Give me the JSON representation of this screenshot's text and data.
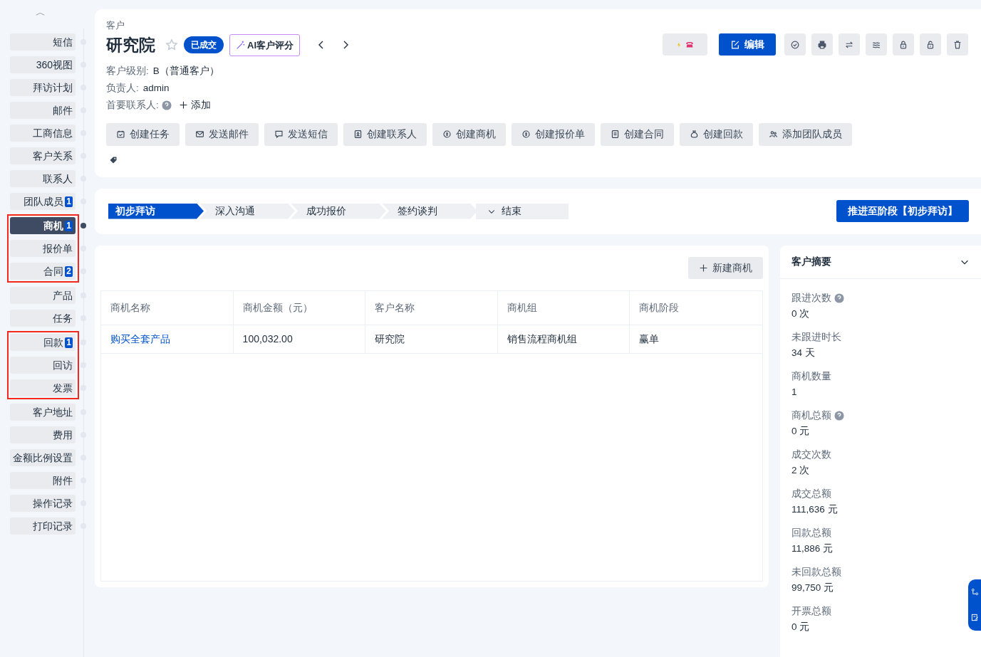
{
  "sidebar": {
    "collapse_glyph": "︿",
    "groups": [
      {
        "highlighted": false,
        "items": [
          {
            "label": "短信",
            "selected": false
          },
          {
            "label": "360视图",
            "selected": false
          },
          {
            "label": "拜访计划",
            "selected": false
          },
          {
            "label": "邮件",
            "selected": false
          },
          {
            "label": "工商信息",
            "selected": false
          },
          {
            "label": "客户关系",
            "selected": false
          },
          {
            "label": "联系人",
            "selected": false
          },
          {
            "label": "团队成员",
            "count": "1",
            "selected": false
          }
        ]
      },
      {
        "highlighted": true,
        "items": [
          {
            "label": "商机",
            "count": "1",
            "selected": true
          },
          {
            "label": "报价单",
            "selected": false
          },
          {
            "label": "合同",
            "count": "2",
            "selected": false
          }
        ]
      },
      {
        "highlighted": false,
        "items": [
          {
            "label": "产品",
            "selected": false
          },
          {
            "label": "任务",
            "selected": false
          }
        ]
      },
      {
        "highlighted": true,
        "items": [
          {
            "label": "回款",
            "count": "1",
            "selected": false
          },
          {
            "label": "回访",
            "selected": false
          },
          {
            "label": "发票",
            "selected": false
          }
        ]
      },
      {
        "highlighted": false,
        "items": [
          {
            "label": "客户地址",
            "selected": false
          },
          {
            "label": "费用",
            "selected": false
          },
          {
            "label": "金额比例设置",
            "selected": false
          },
          {
            "label": "附件",
            "selected": false
          },
          {
            "label": "操作记录",
            "selected": false
          },
          {
            "label": "打印记录",
            "selected": false
          }
        ]
      }
    ]
  },
  "header": {
    "breadcrumb": "客户",
    "title": "研究院",
    "starred": false,
    "status_badge": "已成交",
    "ai_button": "AI客户评分",
    "fields": [
      {
        "label": "客户级别:",
        "value": "B（普通客户）"
      },
      {
        "label": "负责人:",
        "value": "admin"
      }
    ],
    "primary_contact": {
      "label": "首要联系人:",
      "add": "添加"
    },
    "edit_button": "编辑",
    "actions": [
      "创建任务",
      "发送邮件",
      "发送短信",
      "创建联系人",
      "创建商机",
      "创建报价单",
      "创建合同",
      "创建回款",
      "添加团队成员"
    ]
  },
  "stages": {
    "steps": [
      {
        "label": "初步拜访",
        "selected": true,
        "kind": "step"
      },
      {
        "label": "深入沟通",
        "selected": false,
        "kind": "step"
      },
      {
        "label": "成功报价",
        "selected": false,
        "kind": "step"
      },
      {
        "label": "签约谈判",
        "selected": false,
        "kind": "step"
      },
      {
        "label": "结束",
        "selected": false,
        "kind": "end"
      }
    ],
    "advance_button": "推进至阶段【初步拜访】"
  },
  "opportunities": {
    "new_button": "新建商机",
    "columns": [
      "商机名称",
      "商机金额（元）",
      "客户名称",
      "商机组",
      "商机阶段"
    ],
    "rows": [
      [
        "购买全套产品",
        "100,032.00",
        "研究院",
        "销售流程商机组",
        "赢单"
      ]
    ]
  },
  "summary": {
    "title": "客户摘要",
    "expanded": true,
    "items": [
      {
        "label": "跟进次数",
        "help": true,
        "value": "0 次"
      },
      {
        "label": "未跟进时长",
        "help": false,
        "value": "34 天"
      },
      {
        "label": "商机数量",
        "help": false,
        "value": "1"
      },
      {
        "label": "商机总额",
        "help": true,
        "value": "0 元"
      },
      {
        "label": "成交次数",
        "help": false,
        "value": "2 次"
      },
      {
        "label": "成交总额",
        "help": false,
        "value": "111,636 元"
      },
      {
        "label": "回款总额",
        "help": false,
        "value": "11,886 元"
      },
      {
        "label": "未回款总额",
        "help": false,
        "value": "99,750 元"
      },
      {
        "label": "开票总额",
        "help": false,
        "value": "0 元"
      }
    ]
  }
}
